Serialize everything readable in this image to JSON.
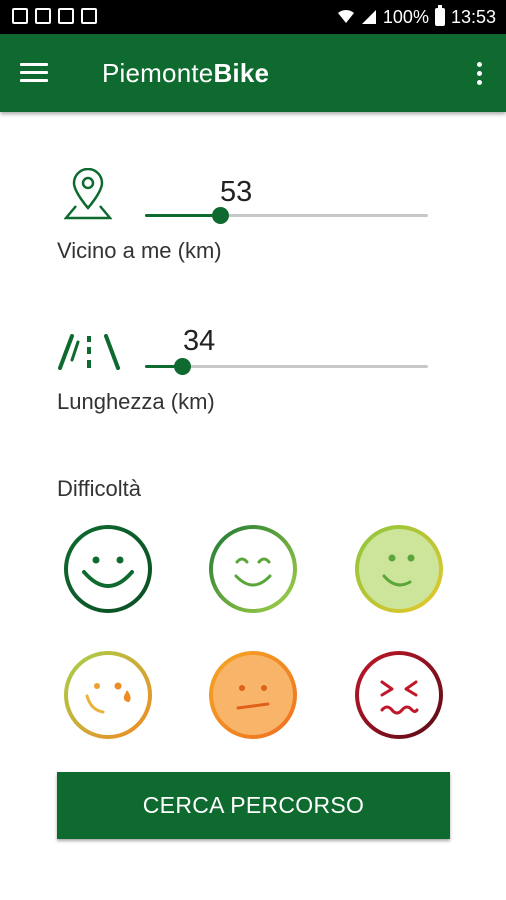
{
  "status_bar": {
    "battery": "100%",
    "time": "13:53"
  },
  "app_bar": {
    "title_part1": "Piemonte",
    "title_part2": "Bike"
  },
  "near_me": {
    "value": "53",
    "label": "Vicino a me (km)",
    "fraction": 0.265
  },
  "length": {
    "value": "34",
    "label": "Lunghezza (km)",
    "fraction": 0.13
  },
  "difficulty": {
    "title": "Difficoltà",
    "levels": [
      {
        "name": "very-easy",
        "ring": "#0e6a2f"
      },
      {
        "name": "easy",
        "ring": "#8cc63e"
      },
      {
        "name": "moderate",
        "ring": "#b9dc5a"
      },
      {
        "name": "medium",
        "ring": "#f0a030"
      },
      {
        "name": "hard",
        "ring": "#f08a24"
      },
      {
        "name": "very-hard",
        "ring": "#a01c2c"
      }
    ]
  },
  "actions": {
    "search": "CERCA PERCORSO"
  },
  "colors": {
    "primary": "#0e6a2f",
    "track": "#c8c8c8"
  }
}
